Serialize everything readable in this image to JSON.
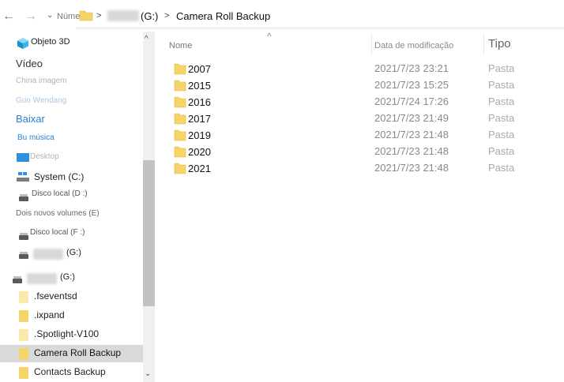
{
  "toolbar": {
    "back_glyph": "←",
    "forward_glyph": "→",
    "recent_glyph": "⌄"
  },
  "address": {
    "label": "Número",
    "separator": ">",
    "drive_label": "(G:)",
    "current": "Camera Roll Backup"
  },
  "sidebar": {
    "items": [
      {
        "label": "Objeto 3D"
      },
      {
        "label": "Vídeo"
      },
      {
        "label": "China imagem"
      },
      {
        "label": "Guo Wendang"
      },
      {
        "label": "Baixar"
      },
      {
        "label": "Bu música"
      },
      {
        "label": "Desktop"
      },
      {
        "label": "System (C:)"
      },
      {
        "label": "Disco local (D :)"
      },
      {
        "label": "Dois novos volumes (E)"
      },
      {
        "label": "Disco local (F :)"
      },
      {
        "label": "(G:)"
      },
      {
        "label": "(G:)"
      },
      {
        "label": ".fseventsd"
      },
      {
        "label": ".ixpand"
      },
      {
        "label": ".Spotlight-V100"
      },
      {
        "label": "Camera Roll Backup"
      },
      {
        "label": "Contacts Backup"
      }
    ]
  },
  "columns": {
    "sort_glyph": "^",
    "name": "Nome",
    "date": "Data de modificação",
    "type": "Tipo"
  },
  "files": [
    {
      "name": "2007",
      "date": "2021/7/23 23:21",
      "type": "Pasta"
    },
    {
      "name": "2015",
      "date": "2021/7/23 15:25",
      "type": "Pasta"
    },
    {
      "name": "2016",
      "date": "2021/7/24 17:26",
      "type": "Pasta"
    },
    {
      "name": "2017",
      "date": "2021/7/23 21:49",
      "type": "Pasta"
    },
    {
      "name": "2019",
      "date": "2021/7/23 21:48",
      "type": "Pasta"
    },
    {
      "name": "2020",
      "date": "2021/7/23 21:48",
      "type": "Pasta"
    },
    {
      "name": "2021",
      "date": "2021/7/23 21:48",
      "type": "Pasta"
    }
  ],
  "scrollbar": {
    "up_glyph": "^",
    "down_glyph": "⌄"
  },
  "colors": {
    "folder": "#f6d468",
    "folder_pale": "#fbe9a9",
    "selection": "#d9d9d9",
    "accent_blue": "#1a73c8"
  }
}
